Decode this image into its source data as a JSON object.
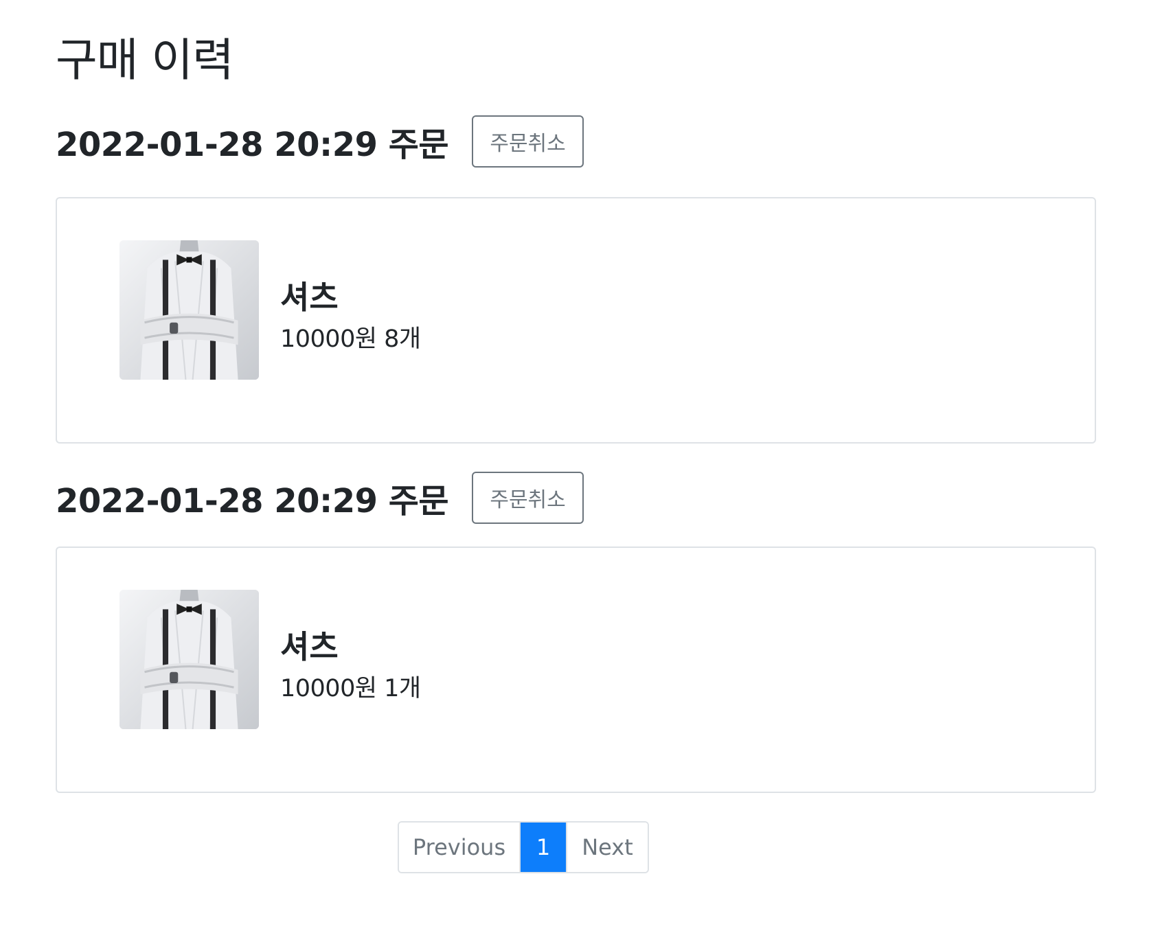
{
  "page": {
    "title": "구매 이력"
  },
  "orders": [
    {
      "title": "2022-01-28 20:29 주문",
      "cancel_label": "주문취소",
      "item": {
        "name": "셔츠",
        "detail": "10000원 8개"
      }
    },
    {
      "title": "2022-01-28 20:29 주문",
      "cancel_label": "주문취소",
      "item": {
        "name": "셔츠",
        "detail": "10000원 1개"
      }
    }
  ],
  "pagination": {
    "previous_label": "Previous",
    "current_page": "1",
    "next_label": "Next"
  },
  "colors": {
    "accent": "#0d7efb",
    "button_outline": "#6c757d",
    "card_border": "#dee2e6",
    "text": "#212529"
  },
  "icons": {
    "product_image": "shirt-product-image"
  }
}
